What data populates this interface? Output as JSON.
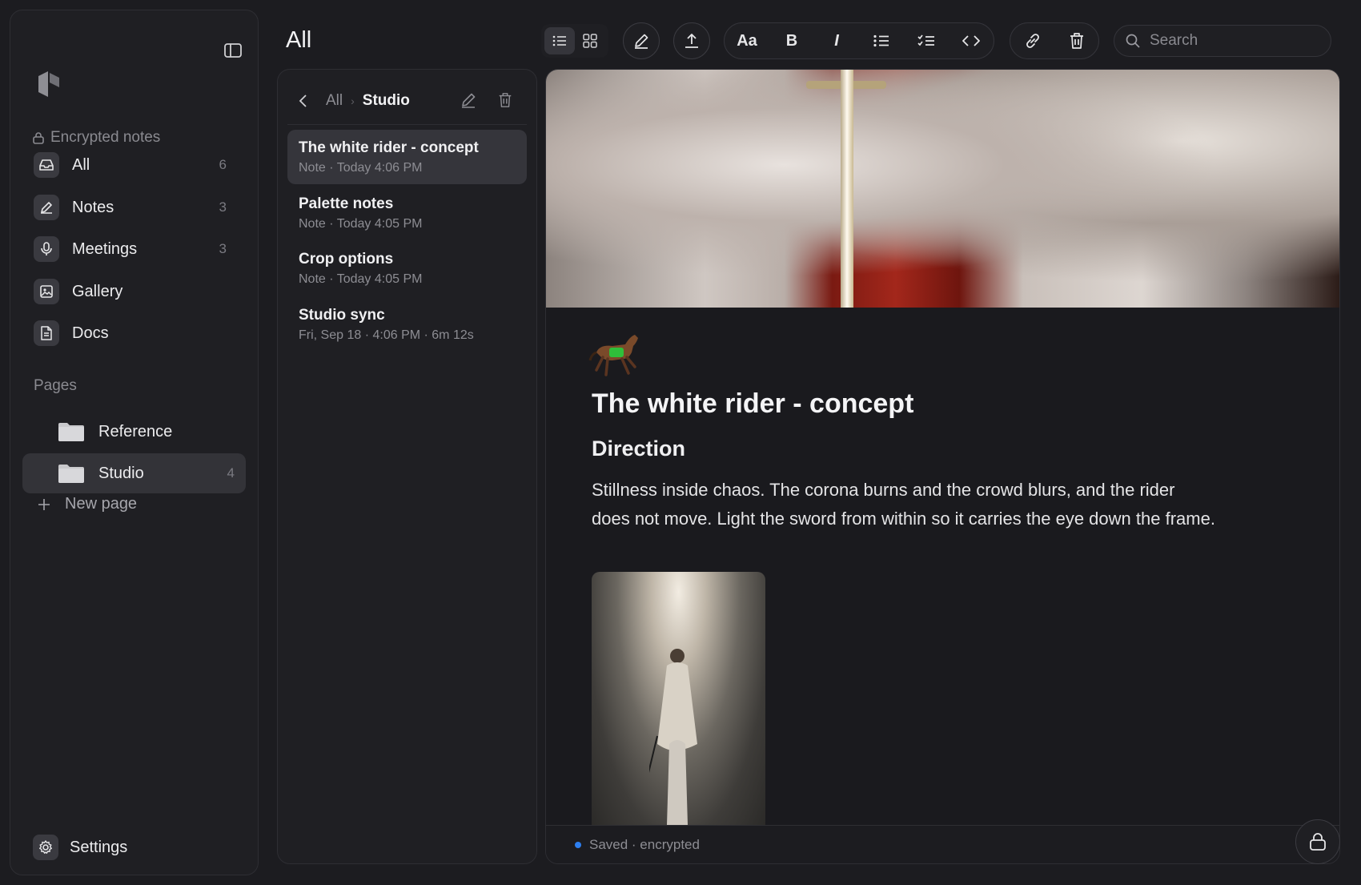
{
  "sidebar": {
    "section_label": "Encrypted notes",
    "nav": [
      {
        "label": "All",
        "count": "6",
        "icon": "inbox-icon"
      },
      {
        "label": "Notes",
        "count": "3",
        "icon": "pencil-icon"
      },
      {
        "label": "Meetings",
        "count": "3",
        "icon": "microphone-icon"
      },
      {
        "label": "Gallery",
        "count": "",
        "icon": "image-icon"
      },
      {
        "label": "Docs",
        "count": "",
        "icon": "document-icon"
      }
    ],
    "pages_label": "Pages",
    "pages": [
      {
        "label": "Reference",
        "count": ""
      },
      {
        "label": "Studio",
        "count": "4"
      }
    ],
    "new_page_label": "New page",
    "settings_label": "Settings"
  },
  "header": {
    "title": "All",
    "format_text_label": "Aa",
    "bold_label": "B",
    "italic_label": "I",
    "search_placeholder": "Search"
  },
  "list": {
    "breadcrumb_root": "All",
    "breadcrumb_current": "Studio",
    "notes": [
      {
        "title": "The white rider - concept",
        "meta": "Note · Today 4:06 PM"
      },
      {
        "title": "Palette notes",
        "meta": "Note · Today 4:05 PM"
      },
      {
        "title": "Crop options",
        "meta": "Note · Today 4:05 PM"
      },
      {
        "title": "Studio sync",
        "meta": "Fri, Sep 18 · 4:06 PM · 6m 12s"
      }
    ]
  },
  "editor": {
    "title": "The white rider - concept",
    "heading": "Direction",
    "paragraph": "Stillness inside chaos. The corona burns and the crowd blurs, and the rider does not move. Light the sword from within so it carries the eye down the frame.",
    "status": "Saved · encrypted"
  },
  "colors": {
    "background": "#1c1c20",
    "panel": "#1f1f23",
    "active_item": "#35353b",
    "status_dot": "#2d7ff0"
  }
}
